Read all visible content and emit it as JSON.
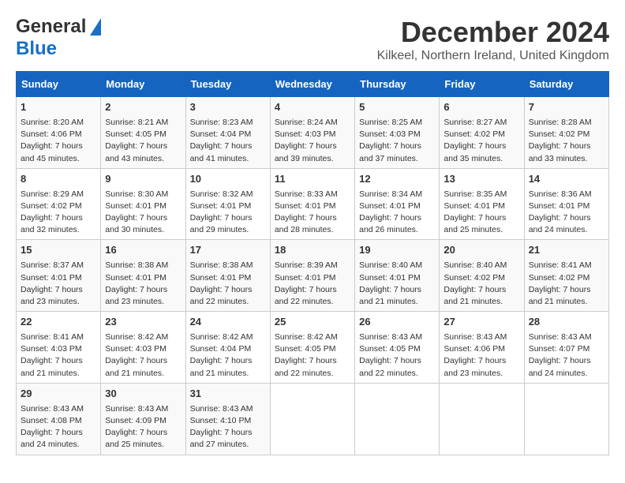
{
  "header": {
    "logo_general": "General",
    "logo_blue": "Blue",
    "month_title": "December 2024",
    "location": "Kilkeel, Northern Ireland, United Kingdom"
  },
  "days_of_week": [
    "Sunday",
    "Monday",
    "Tuesday",
    "Wednesday",
    "Thursday",
    "Friday",
    "Saturday"
  ],
  "weeks": [
    [
      {
        "day": "1",
        "sunrise": "Sunrise: 8:20 AM",
        "sunset": "Sunset: 4:06 PM",
        "daylight": "Daylight: 7 hours and 45 minutes."
      },
      {
        "day": "2",
        "sunrise": "Sunrise: 8:21 AM",
        "sunset": "Sunset: 4:05 PM",
        "daylight": "Daylight: 7 hours and 43 minutes."
      },
      {
        "day": "3",
        "sunrise": "Sunrise: 8:23 AM",
        "sunset": "Sunset: 4:04 PM",
        "daylight": "Daylight: 7 hours and 41 minutes."
      },
      {
        "day": "4",
        "sunrise": "Sunrise: 8:24 AM",
        "sunset": "Sunset: 4:03 PM",
        "daylight": "Daylight: 7 hours and 39 minutes."
      },
      {
        "day": "5",
        "sunrise": "Sunrise: 8:25 AM",
        "sunset": "Sunset: 4:03 PM",
        "daylight": "Daylight: 7 hours and 37 minutes."
      },
      {
        "day": "6",
        "sunrise": "Sunrise: 8:27 AM",
        "sunset": "Sunset: 4:02 PM",
        "daylight": "Daylight: 7 hours and 35 minutes."
      },
      {
        "day": "7",
        "sunrise": "Sunrise: 8:28 AM",
        "sunset": "Sunset: 4:02 PM",
        "daylight": "Daylight: 7 hours and 33 minutes."
      }
    ],
    [
      {
        "day": "8",
        "sunrise": "Sunrise: 8:29 AM",
        "sunset": "Sunset: 4:02 PM",
        "daylight": "Daylight: 7 hours and 32 minutes."
      },
      {
        "day": "9",
        "sunrise": "Sunrise: 8:30 AM",
        "sunset": "Sunset: 4:01 PM",
        "daylight": "Daylight: 7 hours and 30 minutes."
      },
      {
        "day": "10",
        "sunrise": "Sunrise: 8:32 AM",
        "sunset": "Sunset: 4:01 PM",
        "daylight": "Daylight: 7 hours and 29 minutes."
      },
      {
        "day": "11",
        "sunrise": "Sunrise: 8:33 AM",
        "sunset": "Sunset: 4:01 PM",
        "daylight": "Daylight: 7 hours and 28 minutes."
      },
      {
        "day": "12",
        "sunrise": "Sunrise: 8:34 AM",
        "sunset": "Sunset: 4:01 PM",
        "daylight": "Daylight: 7 hours and 26 minutes."
      },
      {
        "day": "13",
        "sunrise": "Sunrise: 8:35 AM",
        "sunset": "Sunset: 4:01 PM",
        "daylight": "Daylight: 7 hours and 25 minutes."
      },
      {
        "day": "14",
        "sunrise": "Sunrise: 8:36 AM",
        "sunset": "Sunset: 4:01 PM",
        "daylight": "Daylight: 7 hours and 24 minutes."
      }
    ],
    [
      {
        "day": "15",
        "sunrise": "Sunrise: 8:37 AM",
        "sunset": "Sunset: 4:01 PM",
        "daylight": "Daylight: 7 hours and 23 minutes."
      },
      {
        "day": "16",
        "sunrise": "Sunrise: 8:38 AM",
        "sunset": "Sunset: 4:01 PM",
        "daylight": "Daylight: 7 hours and 23 minutes."
      },
      {
        "day": "17",
        "sunrise": "Sunrise: 8:38 AM",
        "sunset": "Sunset: 4:01 PM",
        "daylight": "Daylight: 7 hours and 22 minutes."
      },
      {
        "day": "18",
        "sunrise": "Sunrise: 8:39 AM",
        "sunset": "Sunset: 4:01 PM",
        "daylight": "Daylight: 7 hours and 22 minutes."
      },
      {
        "day": "19",
        "sunrise": "Sunrise: 8:40 AM",
        "sunset": "Sunset: 4:01 PM",
        "daylight": "Daylight: 7 hours and 21 minutes."
      },
      {
        "day": "20",
        "sunrise": "Sunrise: 8:40 AM",
        "sunset": "Sunset: 4:02 PM",
        "daylight": "Daylight: 7 hours and 21 minutes."
      },
      {
        "day": "21",
        "sunrise": "Sunrise: 8:41 AM",
        "sunset": "Sunset: 4:02 PM",
        "daylight": "Daylight: 7 hours and 21 minutes."
      }
    ],
    [
      {
        "day": "22",
        "sunrise": "Sunrise: 8:41 AM",
        "sunset": "Sunset: 4:03 PM",
        "daylight": "Daylight: 7 hours and 21 minutes."
      },
      {
        "day": "23",
        "sunrise": "Sunrise: 8:42 AM",
        "sunset": "Sunset: 4:03 PM",
        "daylight": "Daylight: 7 hours and 21 minutes."
      },
      {
        "day": "24",
        "sunrise": "Sunrise: 8:42 AM",
        "sunset": "Sunset: 4:04 PM",
        "daylight": "Daylight: 7 hours and 21 minutes."
      },
      {
        "day": "25",
        "sunrise": "Sunrise: 8:42 AM",
        "sunset": "Sunset: 4:05 PM",
        "daylight": "Daylight: 7 hours and 22 minutes."
      },
      {
        "day": "26",
        "sunrise": "Sunrise: 8:43 AM",
        "sunset": "Sunset: 4:05 PM",
        "daylight": "Daylight: 7 hours and 22 minutes."
      },
      {
        "day": "27",
        "sunrise": "Sunrise: 8:43 AM",
        "sunset": "Sunset: 4:06 PM",
        "daylight": "Daylight: 7 hours and 23 minutes."
      },
      {
        "day": "28",
        "sunrise": "Sunrise: 8:43 AM",
        "sunset": "Sunset: 4:07 PM",
        "daylight": "Daylight: 7 hours and 24 minutes."
      }
    ],
    [
      {
        "day": "29",
        "sunrise": "Sunrise: 8:43 AM",
        "sunset": "Sunset: 4:08 PM",
        "daylight": "Daylight: 7 hours and 24 minutes."
      },
      {
        "day": "30",
        "sunrise": "Sunrise: 8:43 AM",
        "sunset": "Sunset: 4:09 PM",
        "daylight": "Daylight: 7 hours and 25 minutes."
      },
      {
        "day": "31",
        "sunrise": "Sunrise: 8:43 AM",
        "sunset": "Sunset: 4:10 PM",
        "daylight": "Daylight: 7 hours and 27 minutes."
      },
      {
        "day": "",
        "sunrise": "",
        "sunset": "",
        "daylight": ""
      },
      {
        "day": "",
        "sunrise": "",
        "sunset": "",
        "daylight": ""
      },
      {
        "day": "",
        "sunrise": "",
        "sunset": "",
        "daylight": ""
      },
      {
        "day": "",
        "sunrise": "",
        "sunset": "",
        "daylight": ""
      }
    ]
  ]
}
